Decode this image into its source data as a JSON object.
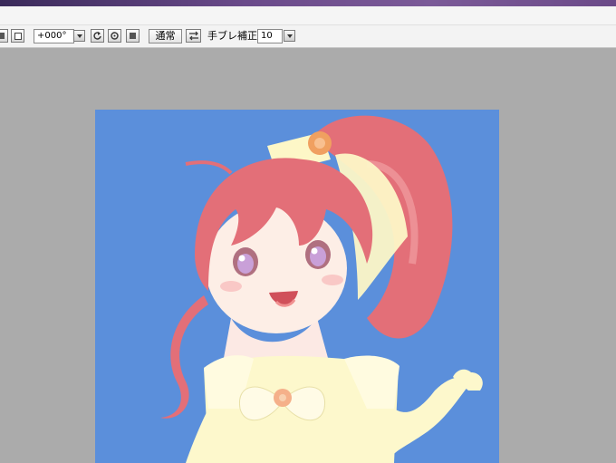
{
  "toolbar": {
    "angle_value": "+000°",
    "blend_mode_label": "通常",
    "stabilizer_label": "手ブレ補正",
    "stabilizer_value": "10",
    "icons": [
      "rotate-left-icon",
      "rotate-right-icon",
      "reset-icon",
      "flip-icon"
    ]
  },
  "canvas": {
    "background_color": "#5b8fdb",
    "subject": "illustration"
  },
  "colors": {
    "workspace": "#ababab",
    "hair": "#e8707a",
    "dress": "#fdf8cc"
  }
}
